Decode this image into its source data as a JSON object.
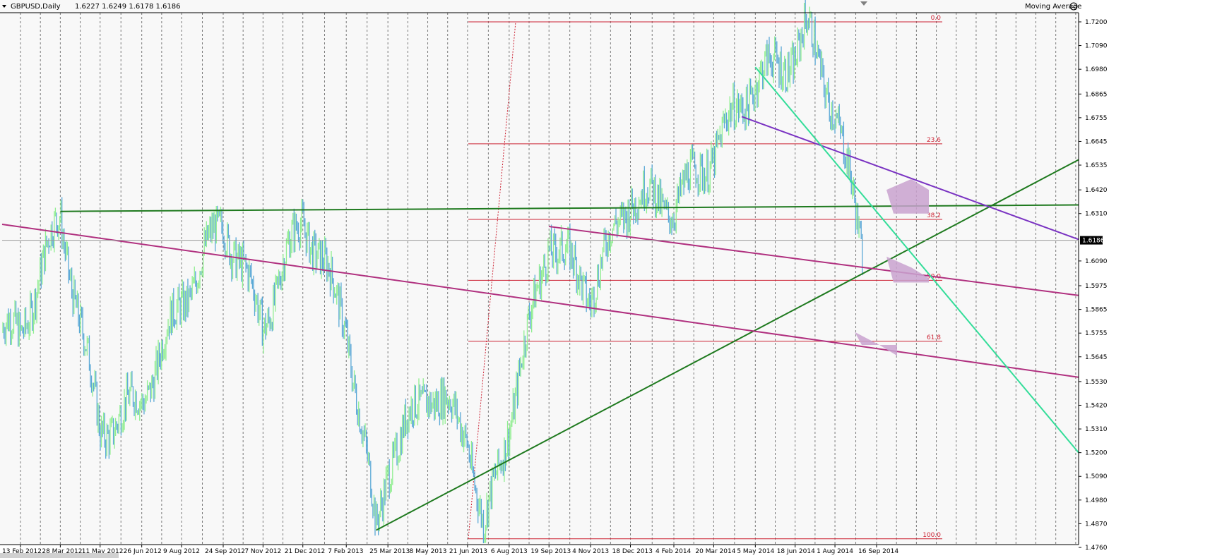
{
  "header": {
    "symbol_label": "GBPUSD,Daily",
    "ohlc_label": "1.6227 1.6249 1.6178 1.6186",
    "indicator_label": "Moving Average"
  },
  "colors": {
    "background": "#f8f8f8",
    "grid": "#7a7a7a",
    "candle_up": "#90ee90",
    "candle_down": "#5aa8d6",
    "fib": "#cc2233",
    "trend_green": "#1f7a1f",
    "trend_magenta": "#b0307f",
    "trend_purple": "#7a33c2",
    "trend_cyan": "#33dd99",
    "last_price_bg": "#000000",
    "ma_fill": "#c9a2cf"
  },
  "chart_data": {
    "type": "candlestick",
    "symbol": "GBPUSD",
    "timeframe": "Daily",
    "last": {
      "open": 1.6227,
      "high": 1.6249,
      "low": 1.6178,
      "close": 1.6186
    },
    "ylim": [
      1.476,
      1.725
    ],
    "y_ticks": [
      "1.7200",
      "1.7090",
      "1.6980",
      "1.6865",
      "1.6755",
      "1.6645",
      "1.6535",
      "1.6420",
      "1.6310",
      "1.6090",
      "1.5975",
      "1.5865",
      "1.5755",
      "1.5645",
      "1.5530",
      "1.5420",
      "1.5310",
      "1.5200",
      "1.5090",
      "1.4980",
      "1.4870",
      "1.4760"
    ],
    "last_price_label": "1.6186",
    "x_ticks": [
      "13 Feb 2012",
      "28 Mar 2012",
      "11 May 2012",
      "26 Jun 2012",
      "9 Aug 2012",
      "24 Sep 2012",
      "7 Nov 2012",
      "21 Dec 2012",
      "7 Feb 2013",
      "25 Mar 2013",
      "8 May 2013",
      "21 Jun 2013",
      "6 Aug 2013",
      "19 Sep 2013",
      "4 Nov 2013",
      "18 Dec 2013",
      "4 Feb 2014",
      "20 Mar 2014",
      "5 May 2014",
      "18 Jun 2014",
      "1 Aug 2014",
      "16 Sep 2014"
    ],
    "price_path": [
      [
        "13 Feb 2012",
        1.576
      ],
      [
        "28 Mar 2012",
        1.63
      ],
      [
        "11 May 2012",
        1.53
      ],
      [
        "26 Jun 2012",
        1.545
      ],
      [
        "9 Aug 2012",
        1.59
      ],
      [
        "24 Sep 2012",
        1.628
      ],
      [
        "7 Nov 2012",
        1.58
      ],
      [
        "21 Dec 2012",
        1.63
      ],
      [
        "7 Feb 2013",
        1.58
      ],
      [
        "12 Mar 2013",
        1.484
      ],
      [
        "25 Mar 2013",
        1.515
      ],
      [
        "8 May 2013",
        1.55
      ],
      [
        "21 Jun 2013",
        1.53
      ],
      [
        "9 Jul 2013",
        1.482
      ],
      [
        "6 Aug 2013",
        1.535
      ],
      [
        "19 Sep 2013",
        1.62
      ],
      [
        "4 Nov 2013",
        1.595
      ],
      [
        "18 Dec 2013",
        1.64
      ],
      [
        "4 Feb 2014",
        1.635
      ],
      [
        "20 Mar 2014",
        1.66
      ],
      [
        "5 May 2014",
        1.693
      ],
      [
        "18 Jun 2014",
        1.705
      ],
      [
        "1 Jul 2014",
        1.717
      ],
      [
        "1 Aug 2014",
        1.68
      ],
      [
        "2 Sep 2014",
        1.61
      ],
      [
        "16 Sep 2014",
        1.6186
      ]
    ],
    "fibonacci": {
      "high": 1.72,
      "low": 1.48,
      "levels": [
        {
          "label": "0.0",
          "price": 1.72
        },
        {
          "label": "23.6",
          "price": 1.6634
        },
        {
          "label": "38.2",
          "price": 1.6283
        },
        {
          "label": "50.0",
          "price": 1.6
        },
        {
          "label": "61.8",
          "price": 1.5717
        },
        {
          "label": "100.0",
          "price": 1.48
        }
      ]
    },
    "trendlines": [
      {
        "color": "trend_green",
        "from": [
          "28 Mar 2012",
          1.632
        ],
        "to": [
          "end",
          1.635
        ]
      },
      {
        "color": "trend_green",
        "from": [
          "12 Mar 2013",
          1.484
        ],
        "to": [
          "end",
          1.656
        ]
      },
      {
        "color": "trend_magenta",
        "from": [
          "start",
          1.626
        ],
        "to": [
          "end",
          1.555
        ]
      },
      {
        "color": "trend_magenta",
        "from": [
          "19 Sep 2013",
          1.625
        ],
        "to": [
          "end",
          1.593
        ]
      },
      {
        "color": "trend_purple",
        "from": [
          "20 Apr 2014",
          1.676
        ],
        "to": [
          "end",
          1.619
        ]
      },
      {
        "color": "trend_cyan",
        "from": [
          "5 May 2014",
          1.699
        ],
        "to": [
          "end",
          1.52
        ]
      }
    ],
    "grid": true
  }
}
